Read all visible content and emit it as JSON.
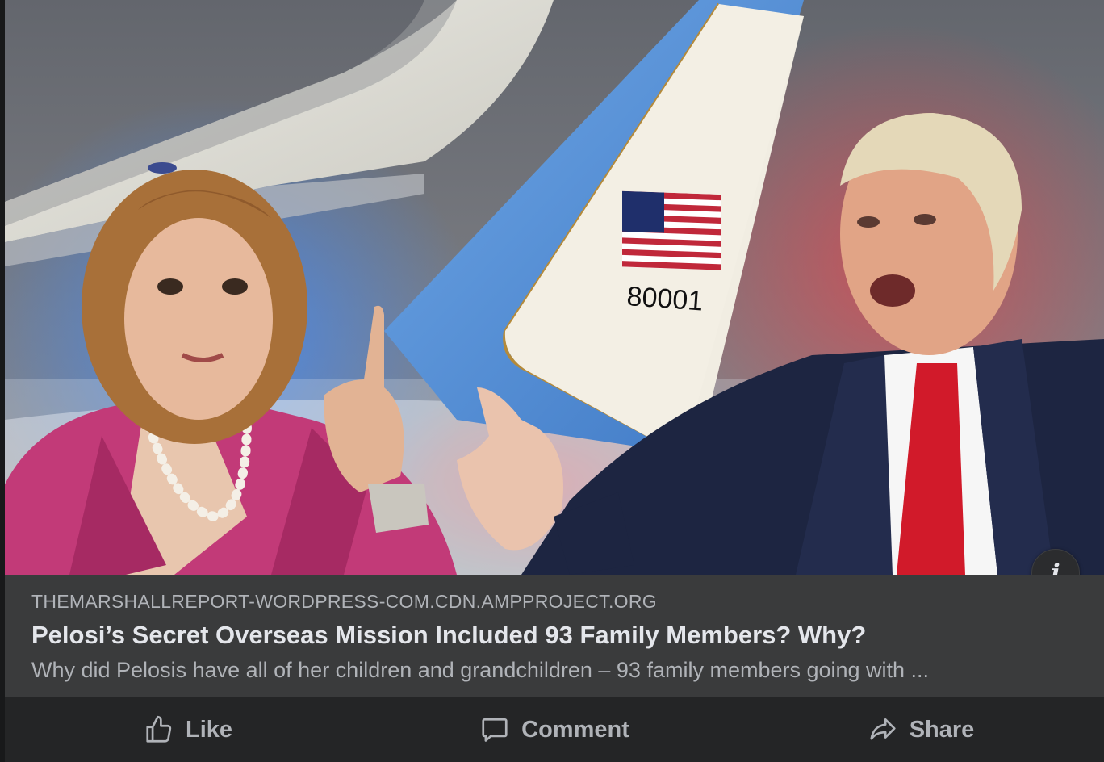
{
  "post": {
    "link_preview": {
      "image": {
        "tail_number": "80001",
        "info_icon": "info-icon",
        "info_symbol": "i"
      },
      "domain": "THEMARSHALLREPORT-WORDPRESS-COM.CDN.AMPPROJECT.ORG",
      "title": "Pelosi’s Secret Overseas Mission Included 93 Family Members? Why?",
      "description": "Why did Pelosis have all of her children and grandchildren – 93 family members going with ..."
    },
    "actions": [
      {
        "label": "Like",
        "icon": "thumbs-up-icon"
      },
      {
        "label": "Comment",
        "icon": "comment-bubble-icon"
      },
      {
        "label": "Share",
        "icon": "share-arrow-icon"
      }
    ]
  },
  "colors": {
    "card_background": "#242526",
    "meta_background": "#3a3b3c",
    "primary_text": "#e4e6eb",
    "secondary_text": "#b0b3b8",
    "tie_red": "#d11a2a",
    "jacket_pink": "#c23a78"
  }
}
